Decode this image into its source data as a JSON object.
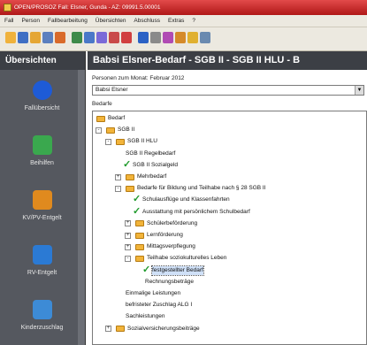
{
  "window": {
    "title": "OPEN/PROSOZ Fall: Elsner, Gunda - AZ: 09991.5.00001"
  },
  "menu": [
    "Fall",
    "Person",
    "Fallbearbeitung",
    "Übersichten",
    "Abschluss",
    "Extras",
    "?"
  ],
  "toolbar": {
    "icons": [
      "folder-icon",
      "save-icon",
      "folder-open-icon",
      "print-icon",
      "people-icon",
      "grid-icon",
      "table-icon",
      "calendar-icon",
      "edit-icon",
      "warning-icon",
      "info-icon",
      "document-icon",
      "book-icon",
      "settings-icon",
      "star-icon",
      "tools-icon"
    ],
    "colors": [
      "#f0b23c",
      "#3f6fc4",
      "#e5a634",
      "#5b7fbf",
      "#d96a2a",
      "#3e8a4a",
      "#4a78c8",
      "#7a6ad8",
      "#c94a4a",
      "#d14040",
      "#2b62c5",
      "#8a8a8a",
      "#b04bb4",
      "#d58a2a",
      "#e0b030",
      "#6a8ab0"
    ]
  },
  "sidebar": {
    "title": "Übersichten",
    "items": [
      {
        "label": "Fallübersicht",
        "icon": "info-icon",
        "color": "#1e5bd6"
      },
      {
        "label": "Beihilfen",
        "icon": "money-icon",
        "color": "#3aa84e"
      },
      {
        "label": "KV/PV-Entgelt",
        "icon": "briefcase-icon",
        "color": "#e08a1e"
      },
      {
        "label": "RV-Entgelt",
        "icon": "document-icon",
        "color": "#2b7ad4"
      },
      {
        "label": "Kinderzuschlag",
        "icon": "family-icon",
        "color": "#3d8bd6"
      }
    ]
  },
  "content": {
    "title": "Babsi Elsner-Bedarf - SGB II - SGB II HLU - B",
    "person_label": "Personen zum Monat: Februar 2012",
    "person_value": "Babsi Elsner",
    "bedarfe_label": "Bedarfe"
  },
  "tree": [
    {
      "label": "Bedarf",
      "level": 0,
      "icon": "folder",
      "toggle": "",
      "checked": false
    },
    {
      "label": "SGB II",
      "level": 1,
      "icon": "folder",
      "toggle": "-",
      "checked": false
    },
    {
      "label": "SGB II HLU",
      "level": 2,
      "icon": "folder",
      "toggle": "-",
      "checked": false
    },
    {
      "label": "SGB II Regelbedarf",
      "level": 3,
      "icon": "none",
      "toggle": "",
      "checked": false
    },
    {
      "label": "SGB II Sozialgeld",
      "level": 3,
      "icon": "none",
      "toggle": "",
      "checked": true
    },
    {
      "label": "Mehrbedarf",
      "level": 3,
      "icon": "folder",
      "toggle": "+",
      "checked": false
    },
    {
      "label": "Bedarfe für Bildung und Teilhabe nach § 28 SGB II",
      "level": 3,
      "icon": "folder",
      "toggle": "-",
      "checked": false
    },
    {
      "label": "Schulausflüge und Klassenfahrten",
      "level": 4,
      "icon": "none",
      "toggle": "",
      "checked": true
    },
    {
      "label": "Ausstattung mit persönlichem Schulbedarf",
      "level": 4,
      "icon": "none",
      "toggle": "",
      "checked": true
    },
    {
      "label": "Schülerbeförderung",
      "level": 4,
      "icon": "folder",
      "toggle": "+",
      "checked": false
    },
    {
      "label": "Lernförderung",
      "level": 4,
      "icon": "folder",
      "toggle": "+",
      "checked": false
    },
    {
      "label": "Mittagsverpflegung",
      "level": 4,
      "icon": "folder",
      "toggle": "+",
      "checked": false
    },
    {
      "label": "Teilhabe soziokulturelles Leben",
      "level": 4,
      "icon": "folder",
      "toggle": "-",
      "checked": false
    },
    {
      "label": "festgestellter Bedarf",
      "level": 5,
      "icon": "none",
      "toggle": "",
      "checked": true,
      "selected": true
    },
    {
      "label": "Rechnungsbeträge",
      "level": 5,
      "icon": "none",
      "toggle": "",
      "checked": false
    },
    {
      "label": "Einmalige Leistungen",
      "level": 3,
      "icon": "none",
      "toggle": "",
      "checked": false
    },
    {
      "label": "befristeter Zuschlag ALG I",
      "level": 3,
      "icon": "none",
      "toggle": "",
      "checked": false
    },
    {
      "label": "Sachleistungen",
      "level": 3,
      "icon": "none",
      "toggle": "",
      "checked": false
    },
    {
      "label": "Sozialversicherungsbeiträge",
      "level": 2,
      "icon": "folder",
      "toggle": "+",
      "checked": false
    }
  ]
}
